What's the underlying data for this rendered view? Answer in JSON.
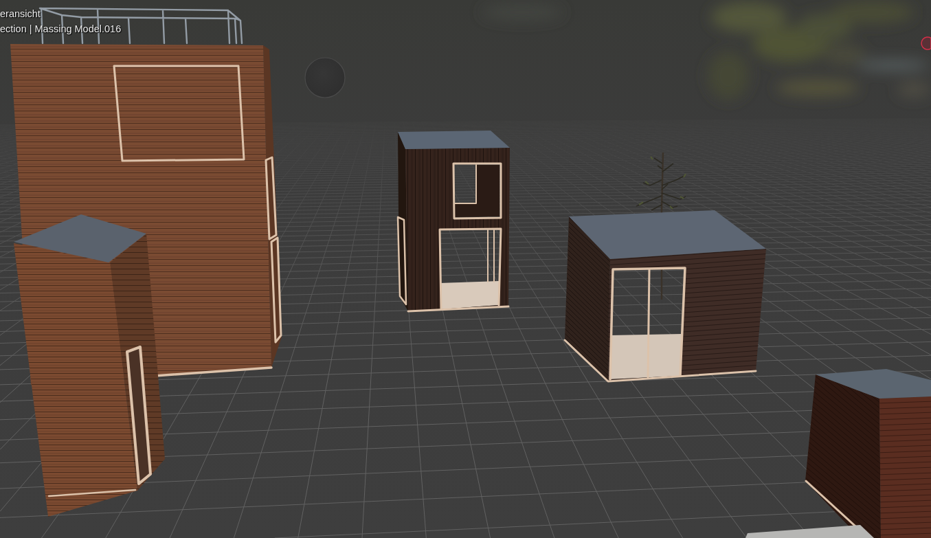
{
  "viewport": {
    "overlay": {
      "view_name": "eransicht",
      "context_line": "ection | Massing Model.016"
    }
  }
}
